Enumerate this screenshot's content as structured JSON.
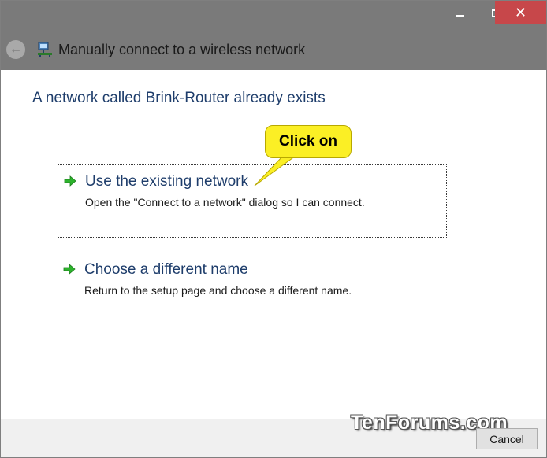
{
  "window": {
    "title": "Manually connect to a wireless network",
    "controls": {
      "minimize_icon": "minimize-icon",
      "maximize_icon": "maximize-icon",
      "close_icon": "close-icon",
      "close_glyph": "✕"
    },
    "back_glyph": "←"
  },
  "content": {
    "heading": "A network called Brink-Router already exists",
    "options": [
      {
        "title": "Use the existing network",
        "description": "Open the \"Connect to a network\" dialog so I can connect.",
        "icon": "green-arrow-icon",
        "focused": true
      },
      {
        "title": "Choose a different name",
        "description": "Return to the setup page and choose a different name.",
        "icon": "green-arrow-icon",
        "focused": false
      }
    ]
  },
  "annotation": {
    "callout_text": "Click on",
    "color": "#fbef25"
  },
  "watermark": "TenForums.com",
  "footer": {
    "cancel_label": "Cancel"
  },
  "colors": {
    "titlebar": "#7a7a7a",
    "close_button": "#c7474a",
    "link_text": "#1e3d6b",
    "arrow": "#2db32d"
  }
}
